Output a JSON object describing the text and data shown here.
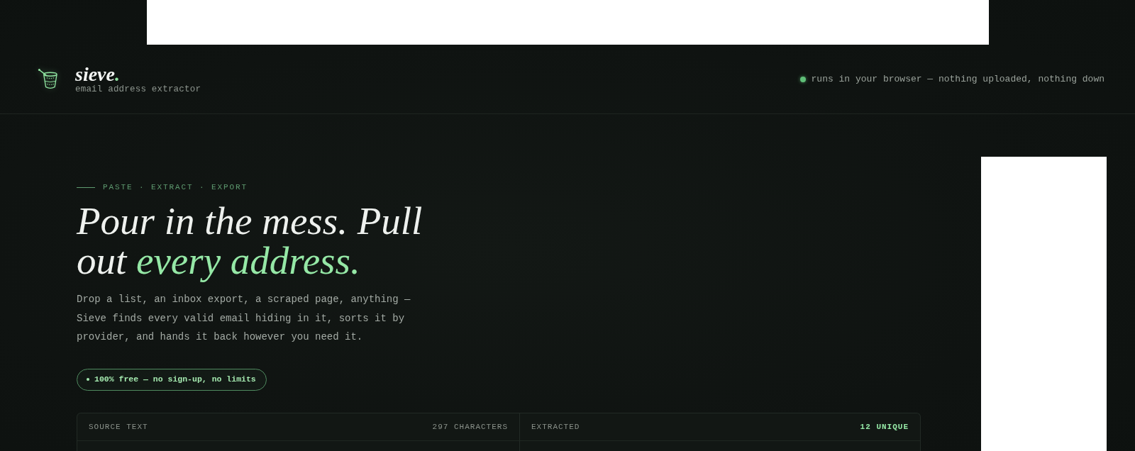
{
  "header": {
    "brand": {
      "name": "sieve",
      "accent": "."
    },
    "tagline": "email address extractor",
    "status": {
      "text": "runs in your browser — nothing uploaded, nothing down",
      "online": true
    }
  },
  "hero": {
    "eyebrow": "PASTE · EXTRACT · EXPORT",
    "headline": {
      "text": "Pour in the mess. Pull out",
      "highlight": "every address."
    },
    "intro": "Drop a list, an inbox export, a scraped page, anything — Sieve finds every valid email hiding in it, sorts it by provider, and hands it back however you need it.",
    "badge": "100% free — no sign-up, no limits"
  },
  "panels": [
    {
      "title": "SOURCE TEXT",
      "count": "297 CHARACTERS",
      "emphasized": false
    },
    {
      "title": "EXTRACTED",
      "count": "12 UNIQUE",
      "emphasized": true
    }
  ]
}
